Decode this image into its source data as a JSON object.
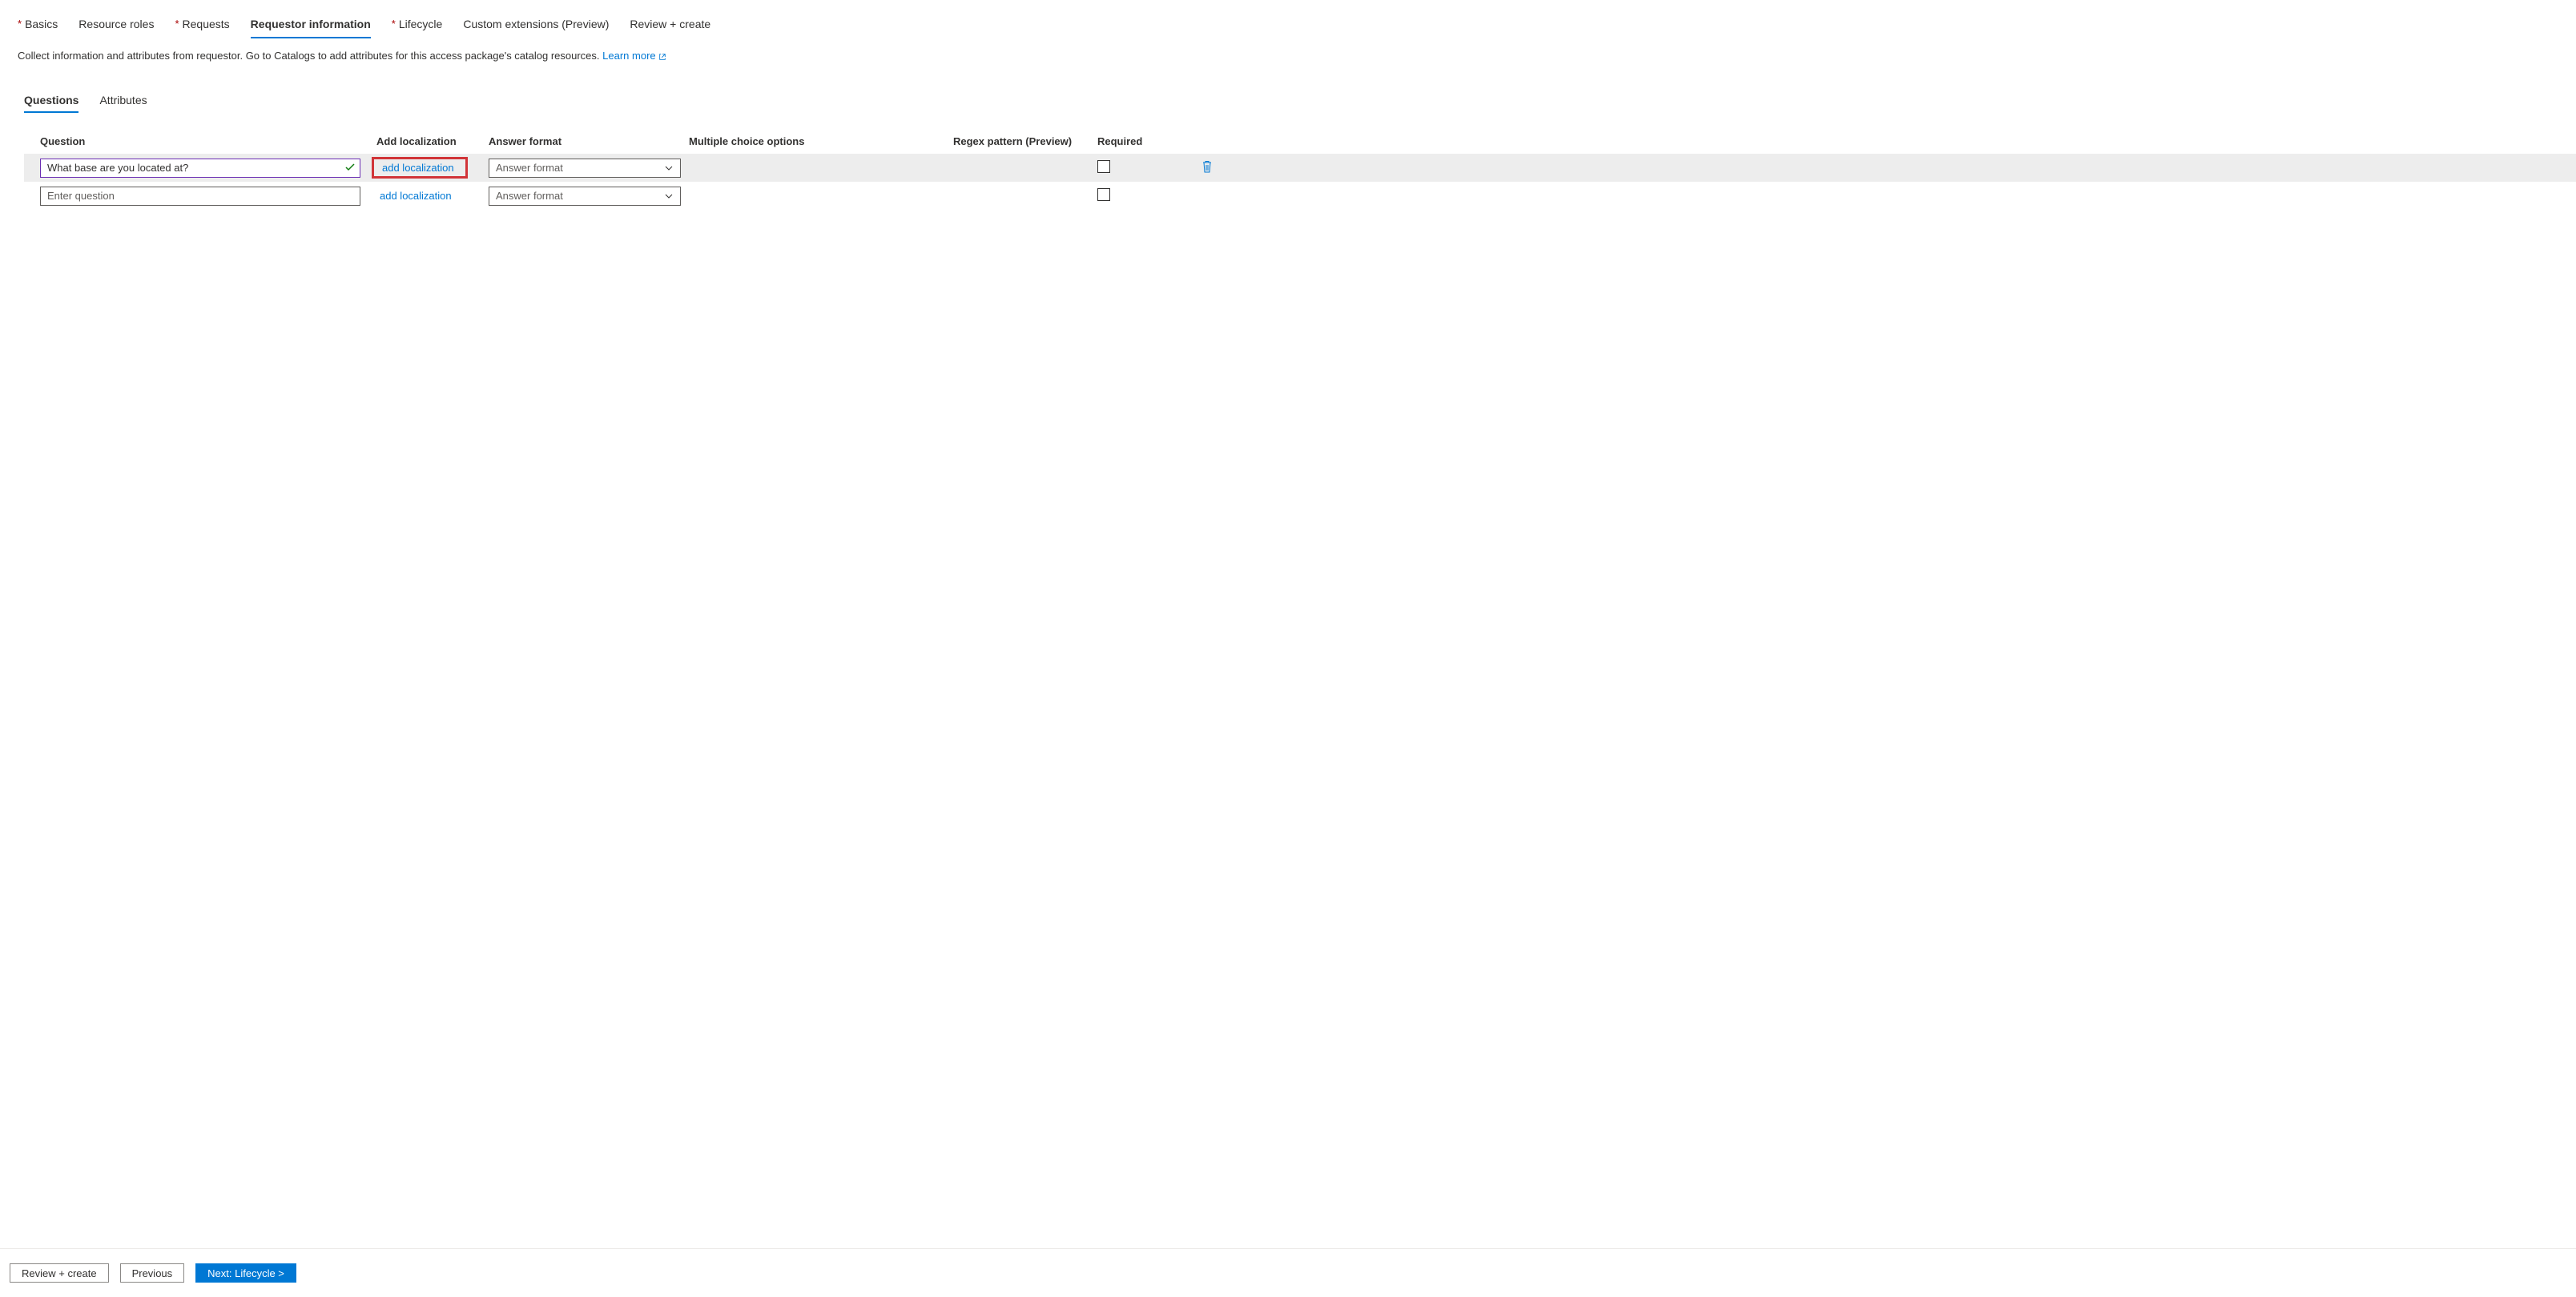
{
  "topTabs": {
    "basics": "Basics",
    "resourceRoles": "Resource roles",
    "requests": "Requests",
    "requestorInfo": "Requestor information",
    "lifecycle": "Lifecycle",
    "customExt": "Custom extensions (Preview)",
    "reviewCreate": "Review + create"
  },
  "description": {
    "text": "Collect information and attributes from requestor. Go to Catalogs to add attributes for this access package's catalog resources.",
    "learnMore": "Learn more"
  },
  "subTabs": {
    "questions": "Questions",
    "attributes": "Attributes"
  },
  "headers": {
    "question": "Question",
    "addLocalization": "Add localization",
    "answerFormat": "Answer format",
    "multipleChoice": "Multiple choice options",
    "regex": "Regex pattern (Preview)",
    "required": "Required"
  },
  "rows": [
    {
      "question": "What base are you located at?",
      "placeholder": "Enter question",
      "localizationLink": "add localization",
      "answerPlaceholder": "Answer format",
      "highlighted": true,
      "valid": true,
      "showDelete": true
    },
    {
      "question": "",
      "placeholder": "Enter question",
      "localizationLink": "add localization",
      "answerPlaceholder": "Answer format",
      "highlighted": false,
      "valid": false,
      "showDelete": false
    }
  ],
  "footer": {
    "reviewCreate": "Review + create",
    "previous": "Previous",
    "next": "Next: Lifecycle >"
  }
}
